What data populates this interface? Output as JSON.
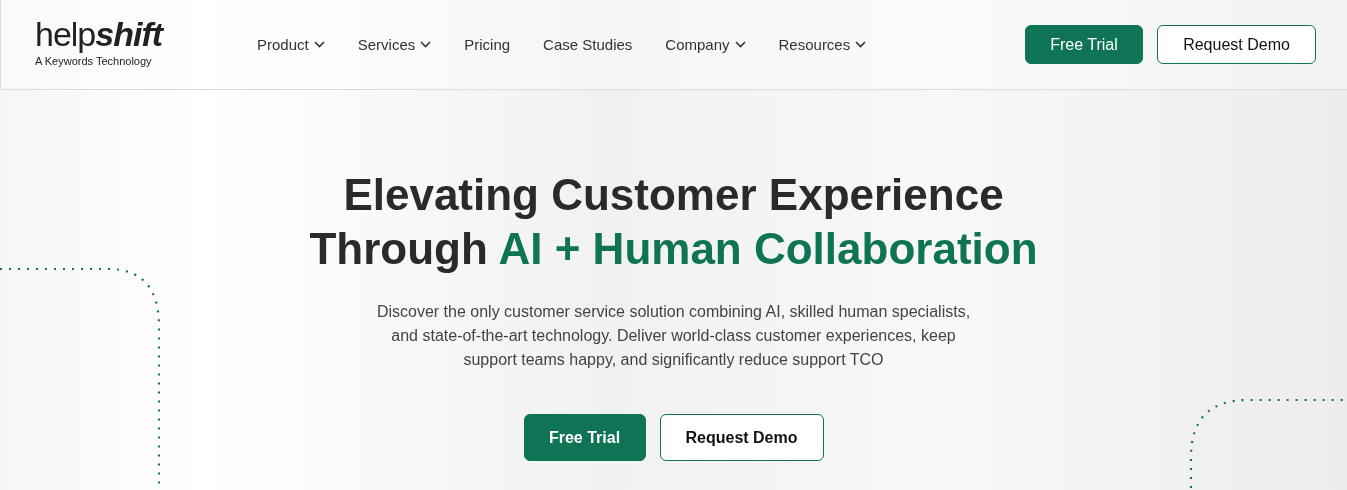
{
  "header": {
    "logo": {
      "wordmark": "help**shift**",
      "tagline": "A Keywords Technology"
    },
    "nav": [
      {
        "label": "Product",
        "kind": "dropdown"
      },
      {
        "label": "Services",
        "kind": "dropdown"
      },
      {
        "label": "Pricing",
        "kind": "link"
      },
      {
        "label": "Case Studies",
        "kind": "link"
      },
      {
        "label": "Company",
        "kind": "dropdown"
      },
      {
        "label": "Resources",
        "kind": "dropdown"
      }
    ],
    "buttons": [
      {
        "label": "Free Trial",
        "kind": "primary"
      },
      {
        "label": "Request Demo",
        "kind": "secondary"
      }
    ]
  },
  "hero": {
    "headline": {
      "line_1": "Elevating Customer Experience",
      "line_2_start": "Through",
      "line_2_highlight": "AI + Human Collaboration"
    },
    "description": "Discover the only customer service solution combining AI, skilled human specialists, and state-of-the-art technology. Deliver world-class customer experiences, keep support teams happy, and significantly reduce support TCO",
    "buttons": [
      {
        "label": "Free Trial",
        "kind": "primary"
      },
      {
        "label": "Request Demo",
        "kind": "secondary"
      }
    ]
  }
}
